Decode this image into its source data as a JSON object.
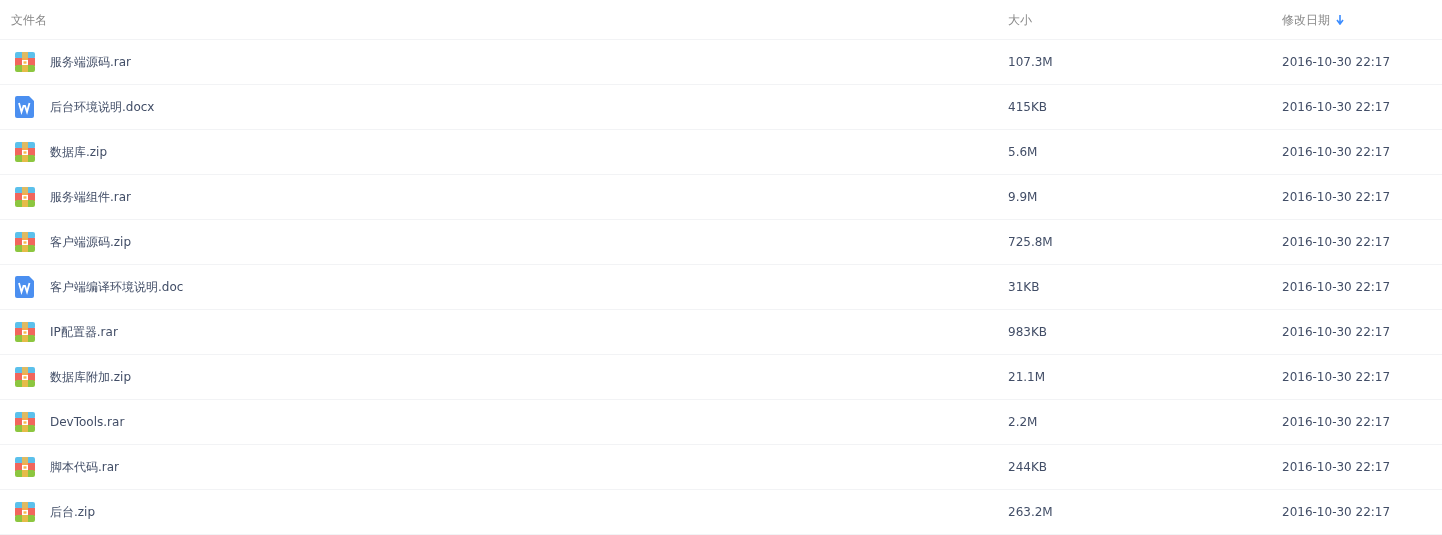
{
  "table": {
    "columns": [
      {
        "label": "文件名",
        "sorted": false
      },
      {
        "label": "大小",
        "sorted": false
      },
      {
        "label": "修改日期",
        "sorted": true
      }
    ],
    "rows": [
      {
        "kind": "archive",
        "name": "服务端源码.rar",
        "size": "107.3M",
        "modified": "2016-10-30 22:17"
      },
      {
        "kind": "document",
        "name": "后台环境说明.docx",
        "size": "415KB",
        "modified": "2016-10-30 22:17"
      },
      {
        "kind": "archive",
        "name": "数据库.zip",
        "size": "5.6M",
        "modified": "2016-10-30 22:17"
      },
      {
        "kind": "archive",
        "name": "服务端组件.rar",
        "size": "9.9M",
        "modified": "2016-10-30 22:17"
      },
      {
        "kind": "archive",
        "name": "客户端源码.zip",
        "size": "725.8M",
        "modified": "2016-10-30 22:17"
      },
      {
        "kind": "document",
        "name": "客户端编译环境说明.doc",
        "size": "31KB",
        "modified": "2016-10-30 22:17"
      },
      {
        "kind": "archive",
        "name": "IP配置器.rar",
        "size": "983KB",
        "modified": "2016-10-30 22:17"
      },
      {
        "kind": "archive",
        "name": "数据库附加.zip",
        "size": "21.1M",
        "modified": "2016-10-30 22:17"
      },
      {
        "kind": "archive",
        "name": "DevTools.rar",
        "size": "2.2M",
        "modified": "2016-10-30 22:17"
      },
      {
        "kind": "archive",
        "name": "脚本代码.rar",
        "size": "244KB",
        "modified": "2016-10-30 22:17"
      },
      {
        "kind": "archive",
        "name": "后台.zip",
        "size": "263.2M",
        "modified": "2016-10-30 22:17"
      }
    ]
  }
}
